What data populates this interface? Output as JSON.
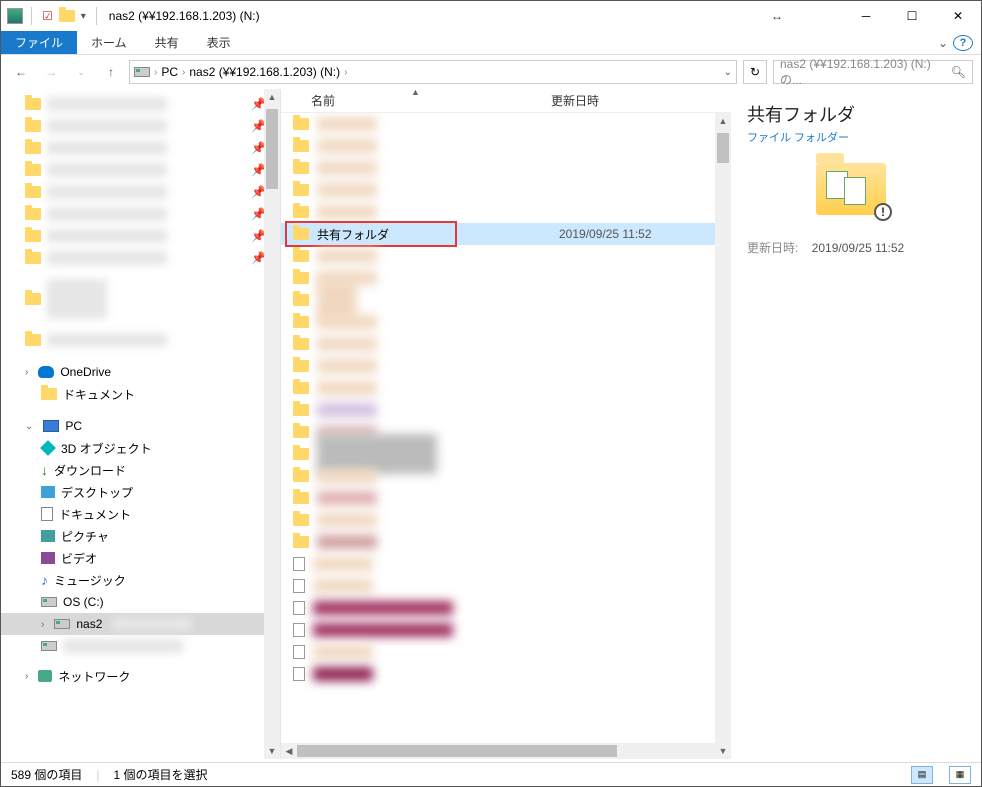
{
  "titlebar": {
    "title": "nas2 (¥¥192.168.1.203) (N:)"
  },
  "ribbon": {
    "file": "ファイル",
    "home": "ホーム",
    "share": "共有",
    "view": "表示"
  },
  "address": {
    "crumb_pc": "PC",
    "crumb_loc": "nas2 (¥¥192.168.1.203) (N:)",
    "search_placeholder": "nas2 (¥¥192.168.1.203) (N:)の..."
  },
  "columns": {
    "name": "名前",
    "date": "更新日時"
  },
  "nav": {
    "onedrive": "OneDrive",
    "documents": "ドキュメント",
    "pc": "PC",
    "objects3d": "3D オブジェクト",
    "downloads": "ダウンロード",
    "desktop": "デスクトップ",
    "docs": "ドキュメント",
    "pictures": "ピクチャ",
    "videos": "ビデオ",
    "music": "ミュージック",
    "osdrive": "OS (C:)",
    "nas2": "nas2",
    "network": "ネットワーク"
  },
  "selected_row": {
    "name": "共有フォルダ",
    "date": "2019/09/25 11:52"
  },
  "details": {
    "title": "共有フォルダ",
    "type": "ファイル フォルダー",
    "date_label": "更新日時:",
    "date_value": "2019/09/25 11:52"
  },
  "status": {
    "count": "589 個の項目",
    "selection": "1 個の項目を選択"
  }
}
